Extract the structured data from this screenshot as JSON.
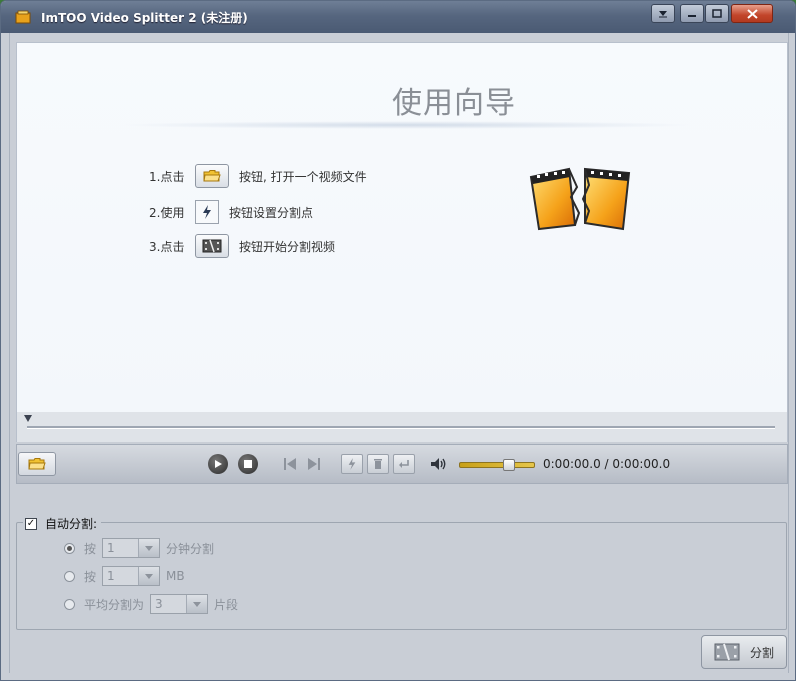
{
  "window": {
    "title": "ImTOO Video Splitter 2 (未注册)"
  },
  "guide": {
    "title": "使用向导",
    "steps": [
      {
        "num": "1.点击",
        "text": "按钮, 打开一个视频文件",
        "icon": "folder-open-icon"
      },
      {
        "num": "2.使用",
        "text": "按钮设置分割点",
        "icon": "split-point-icon"
      },
      {
        "num": "3.点击",
        "text": "按钮开始分割视频",
        "icon": "film-split-icon"
      }
    ]
  },
  "player": {
    "time": "0:00:00.0 / 0:00:00.0",
    "volume_level": 0.6
  },
  "auto_split": {
    "label": "自动分割:",
    "checked": true,
    "options": [
      {
        "prefix": "按",
        "value": "1",
        "suffix": "分钟分割",
        "selected": true
      },
      {
        "prefix": "按",
        "value": "1",
        "suffix": "MB",
        "selected": false
      },
      {
        "prefix": "平均分割为",
        "value": "3",
        "suffix": "片段",
        "selected": false
      }
    ]
  },
  "split_button": {
    "label": "分割"
  },
  "colors": {
    "titlebar": "#56667f",
    "accent_volume": "#e6c64a",
    "preview_bg": "#f5f8fc"
  }
}
